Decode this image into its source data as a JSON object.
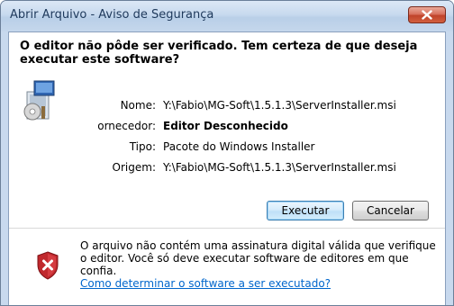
{
  "window": {
    "title": "Abrir Arquivo - Aviso de Segurança"
  },
  "dialog": {
    "question": "O editor não pôde ser verificado. Tem certeza de que deseja executar este software?",
    "fields": {
      "name_label": "Nome:",
      "name_value": "Y:\\Fabio\\MG-Soft\\1.5.1.3\\ServerInstaller.msi",
      "publisher_label": "ornecedor:",
      "publisher_value": "Editor Desconhecido",
      "type_label": "Tipo:",
      "type_value": "Pacote do Windows Installer",
      "origin_label": "Origem:",
      "origin_value": "Y:\\Fabio\\MG-Soft\\1.5.1.3\\ServerInstaller.msi"
    },
    "buttons": {
      "execute": "Executar",
      "cancel": "Cancelar"
    },
    "warning": {
      "text": "O arquivo não contém uma assinatura digital válida que verifique o editor. Você só deve executar software de editores em que confia.",
      "link": "Como determinar o software a ser executado?"
    }
  },
  "icons": {
    "app": "installer-package-icon",
    "warning": "red-shield-x-icon",
    "close": "close-icon"
  },
  "colors": {
    "title_text": "#1e395b",
    "close_button": "#c0432a",
    "link": "#0066cc",
    "shield_red": "#c0282d"
  }
}
